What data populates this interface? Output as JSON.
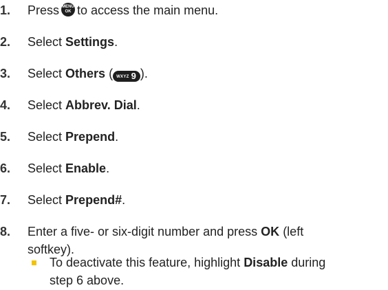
{
  "steps": [
    {
      "number": "1.",
      "pre": "Press",
      "menu_key_top": "MENU",
      "menu_key_bottom": "OK",
      "post": "to access the main menu."
    },
    {
      "number": "2.",
      "pre": "Select",
      "bold": "Settings",
      "post": "."
    },
    {
      "number": "3.",
      "pre": "Select",
      "bold": "Others",
      "paren_open": "(",
      "key_letters": "WXYZ",
      "key_digit": "9",
      "paren_close": ")."
    },
    {
      "number": "4.",
      "pre": "Select",
      "bold": "Abbrev. Dial",
      "post": "."
    },
    {
      "number": "5.",
      "pre": "Select",
      "bold": "Prepend",
      "post": "."
    },
    {
      "number": "6.",
      "pre": "Select",
      "bold": "Enable",
      "post": "."
    },
    {
      "number": "7.",
      "pre": "Select",
      "bold": "Prepend#",
      "post": "."
    },
    {
      "number": "8.",
      "pre": "Enter a five- or six-digit number and press",
      "bold": "OK",
      "post": "(left",
      "line2": "softkey)."
    }
  ],
  "note": {
    "pre": "To deactivate this feature, highlight",
    "bold": "Disable",
    "post": "during",
    "line2": "step 6 above."
  },
  "colors": {
    "bullet": "#f2c400",
    "key_background": "#1f1f1f"
  }
}
